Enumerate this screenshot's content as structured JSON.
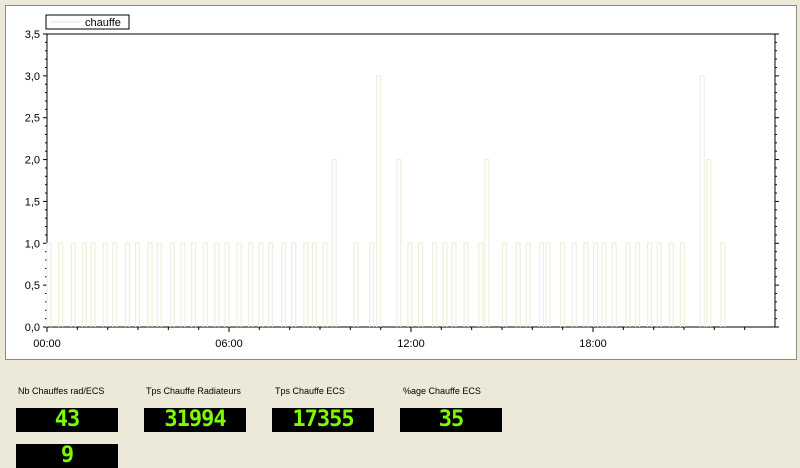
{
  "chart_data": {
    "type": "line",
    "series": [
      {
        "name": "chauffe",
        "color": "#f0eedc",
        "x": [
          "00:00",
          "00:23",
          "00:48",
          "01:10",
          "01:27",
          "01:51",
          "02:10",
          "02:35",
          "02:55",
          "03:20",
          "03:38",
          "04:04",
          "04:25",
          "04:46",
          "05:09",
          "05:32",
          "05:52",
          "06:16",
          "06:39",
          "06:59",
          "07:18",
          "07:44",
          "08:04",
          "08:28",
          "08:45",
          "09:06",
          "09:24",
          "10:07",
          "10:38",
          "10:52",
          "11:32",
          "11:54",
          "12:15",
          "12:43",
          "13:03",
          "13:21",
          "13:45",
          "14:14",
          "14:26",
          "15:01",
          "15:28",
          "15:48",
          "16:14",
          "16:27",
          "16:56",
          "17:19",
          "17:42",
          "18:01",
          "18:18",
          "18:38",
          "19:05",
          "19:24",
          "19:48",
          "20:07",
          "20:31",
          "20:53",
          "21:32",
          "21:45",
          "22:13"
        ],
        "y": [
          1,
          1,
          1,
          1,
          1,
          1,
          1,
          1,
          1,
          1,
          1,
          1,
          1,
          1,
          1,
          1,
          1,
          1,
          1,
          1,
          1,
          1,
          1,
          1,
          1,
          1,
          2,
          1,
          1,
          3,
          2,
          1,
          1,
          1,
          1,
          1,
          1,
          1,
          2,
          1,
          1,
          1,
          1,
          1,
          1,
          1,
          1,
          1,
          1,
          1,
          1,
          1,
          1,
          1,
          1,
          1,
          3,
          2,
          1
        ]
      }
    ],
    "ylim": [
      0,
      3.5
    ],
    "yticks": [
      "0,0",
      "0,5",
      "1,0",
      "1,5",
      "2,0",
      "2,5",
      "3,0",
      "3,5"
    ],
    "xticks": [
      "00:00",
      "06:00",
      "12:00",
      "18:00"
    ],
    "legend_position": "top-left",
    "grid": false
  },
  "counters": [
    {
      "label": "Nb Chauffes rad/ECS",
      "value": "43"
    },
    {
      "label": "Tps Chauffe Radiateurs",
      "value": "31994"
    },
    {
      "label": "Tps Chauffe ECS",
      "value": "17355"
    },
    {
      "label": "%age Chauffe ECS",
      "value": "35"
    }
  ],
  "extra_counter": {
    "value": "9"
  },
  "colors": {
    "background": "#ece9d8",
    "chart_background": "#ffffff",
    "display_background": "#000000",
    "display_digit": "#7cfc00"
  }
}
